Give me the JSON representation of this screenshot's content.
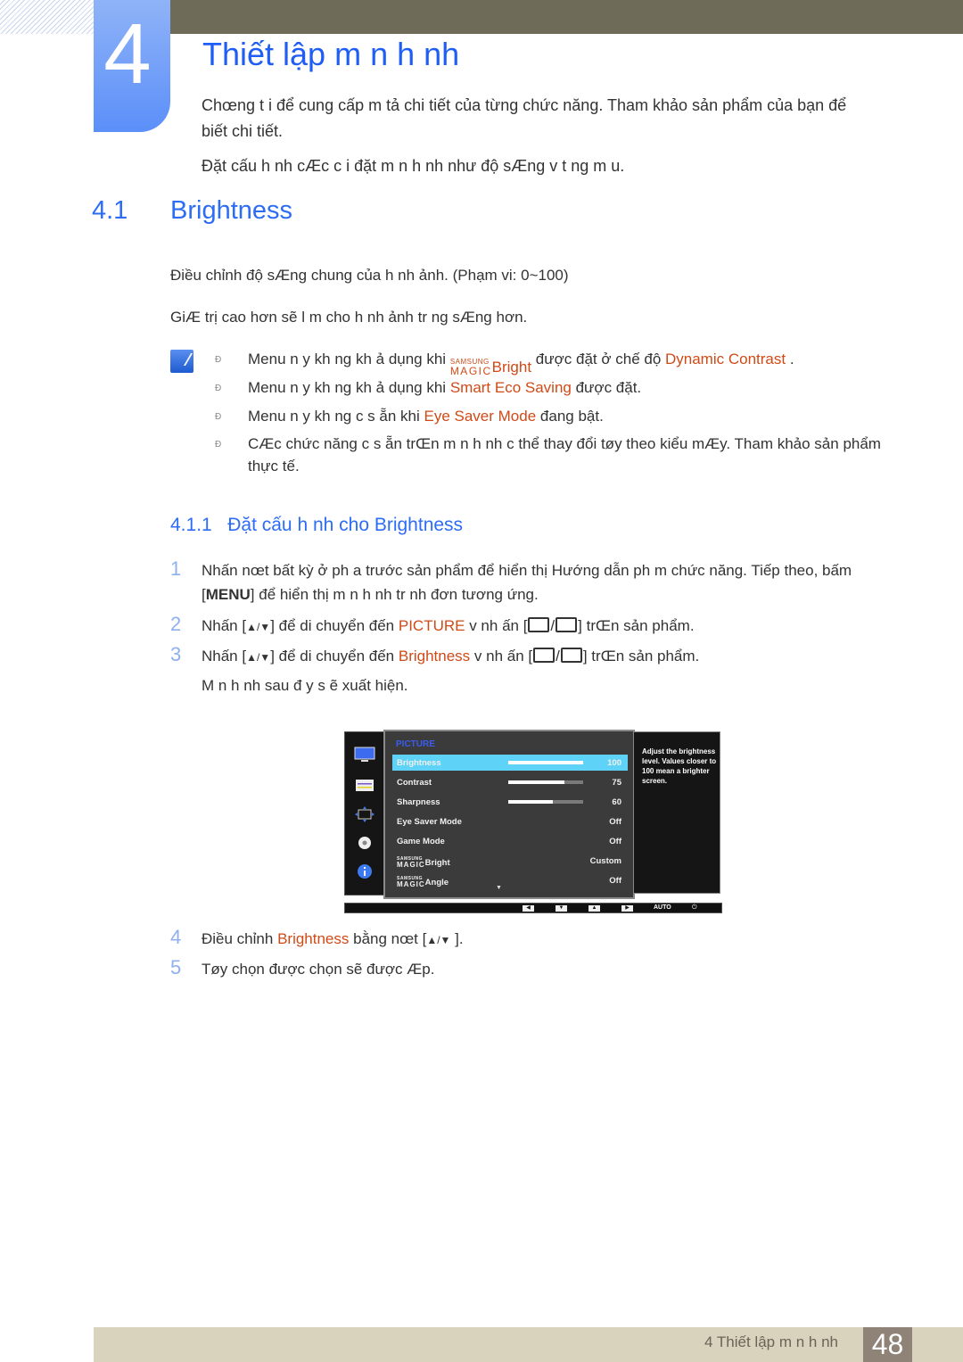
{
  "chapter": {
    "number": "4",
    "title": "Thiết lập m n h nh",
    "intro_line1": "Chœng t i để cung cấp m  tả chi tiết của từng chức năng. Tham khảo sản phẩm của bạn để",
    "intro_line2": "biết chi tiết.",
    "intro_line3": "Đặt cấu h nh cÆc c i đặt m n h nh như  độ sÆng v  t ng m u."
  },
  "section": {
    "number": "4.1",
    "title": "Brightness",
    "para1": "Điều chỉnh độ sÆng chung của h nh ảnh. (Phạm vi: 0~100)",
    "para2": "GiÆ trị cao hơn sẽ l m cho h nh  ảnh tr ng sÆng hơn."
  },
  "notes": {
    "bullet": "Ð",
    "n1_pre": "Menu n y kh ng kh  ả dụng khi ",
    "n1_magic_top": "SAMSUNG",
    "n1_magic_bottom": "MAGIC",
    "n1_magic_word": "Bright",
    "n1_mid": "  được đặt ở chế độ ",
    "n1_hl": "Dynamic Contrast",
    "n1_post": "  .",
    "n2_pre": "Menu n y kh ng kh  ả dụng khi ",
    "n2_hl": "Smart Eco Saving",
    "n2_post": "   được đặt.",
    "n3_pre": "Menu n y kh ng c  s   ẵn khi ",
    "n3_hl": "Eye Saver Mode",
    "n3_post": "  đang bật.",
    "n4_line1": "CÆc chức năng c  s ẵn trŒn m n h nh c  thể thay đổi tøy theo kiểu mÆy. Tham khảo sản phẩm",
    "n4_line2": "thực tế."
  },
  "subsection": {
    "number": "4.1.1",
    "title": "Đặt cấu h nh cho Brightness"
  },
  "steps": [
    {
      "num": "1",
      "line1": "Nhấn nœt bất kỳ ở ph a trước sản phẩm để hiển thị Hướng dẫn ph m chức năng. Tiếp theo, bấm",
      "menu_key": "MENU",
      "line2": " để hiển thị m n h nh tr nh  đơn tương ứng."
    },
    {
      "num": "2",
      "pre": "Nhấn [",
      "arrows": "▲/▼",
      "mid": "] để di chuyển đến ",
      "hl": "PICTURE",
      "mid2": " v  nh ấn [",
      "post": "] trŒn sản phẩm."
    },
    {
      "num": "3",
      "pre": "Nhấn [",
      "arrows": "▲/▼",
      "mid": "] để di chuyển đến ",
      "hl": "Brightness",
      "mid2": "   v  nh ấn [",
      "post": "] trŒn sản phẩm.",
      "line2": "M n h nh sau  đ y s ẽ xuất hiện."
    },
    {
      "num": "4",
      "pre": "Điều chỉnh ",
      "hl": "Brightness",
      "mid": "   bằng nœt [",
      "arrows": "▲/▼",
      "post": " ]."
    },
    {
      "num": "5",
      "text": "Tøy chọn được chọn sẽ được Æp."
    }
  ],
  "osd": {
    "menu_title": "PICTURE",
    "left_icons": [
      "monitor-icon",
      "menu-lines-icon",
      "size-arrows-icon",
      "gear-icon",
      "info-icon"
    ],
    "rows": [
      {
        "label": "Brightness",
        "value": "100",
        "level": 100,
        "selected": true
      },
      {
        "label": "Contrast",
        "value": "75",
        "level": 75
      },
      {
        "label": "Sharpness",
        "value": "60",
        "level": 60
      },
      {
        "label": "Eye Saver Mode",
        "value": "Off"
      },
      {
        "label": "Game Mode",
        "value": "Off"
      },
      {
        "label_top": "SAMSUNG",
        "label_bottom": "MAGIC",
        "label_word": "Bright",
        "value": "Custom"
      },
      {
        "label_top": "SAMSUNG",
        "label_bottom": "MAGIC",
        "label_word": "Angle",
        "value": "Off"
      }
    ],
    "help_text": "Adjust the brightness level. Values closer to 100 mean a brighter screen.",
    "bottom_keys": [
      "◀",
      "▼",
      "▲",
      "▶"
    ],
    "auto_label": "AUTO",
    "power_glyph": "⏻",
    "more_glyph": "▼"
  },
  "footer": {
    "text": "4 Thiết lập m n h nh",
    "page": "48"
  },
  "colors": {
    "heading_blue": "#2d6cf5",
    "highlight_orange": "#d04a17",
    "osd_selected": "#5fd3f7"
  }
}
